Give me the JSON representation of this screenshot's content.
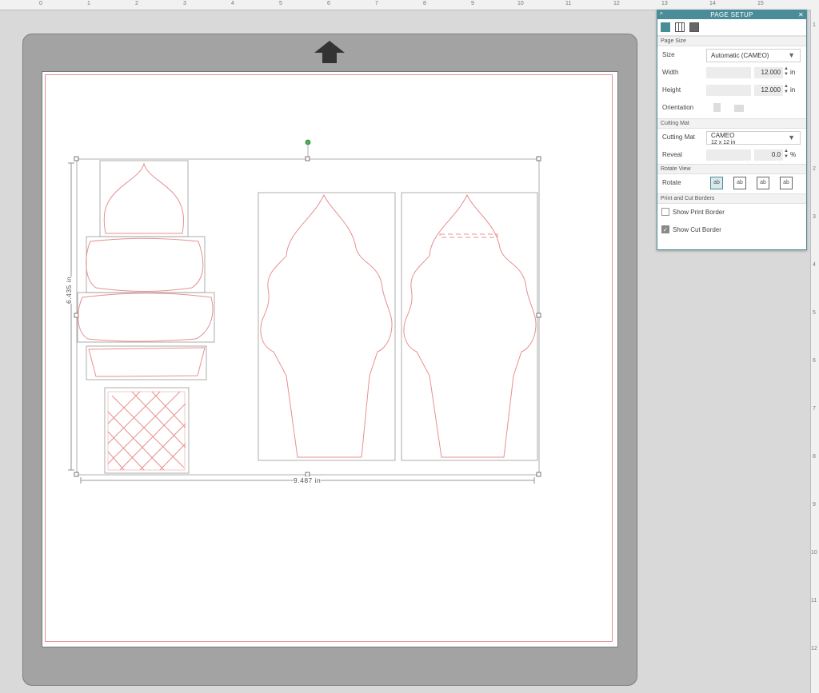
{
  "ruler": {
    "top_labels": [
      "0",
      "1",
      "2",
      "3",
      "4",
      "5",
      "6",
      "7",
      "8",
      "9",
      "10",
      "11",
      "12",
      "13",
      "14",
      "15"
    ],
    "right_labels": [
      "1",
      "2",
      "3",
      "4",
      "5",
      "6",
      "7",
      "8",
      "9",
      "10",
      "11",
      "12"
    ]
  },
  "canvas": {
    "height_dimension": "6.435 in",
    "width_dimension": "9.487 in"
  },
  "panel": {
    "title": "PAGE SETUP",
    "sections": {
      "page_size": "Page Size",
      "cutting_mat": "Cutting Mat",
      "rotate_view": "Rotate View",
      "borders": "Print and Cut Borders"
    },
    "size_label": "Size",
    "size_value": "Automatic (CAMEO)",
    "width_label": "Width",
    "width_value": "12.000",
    "height_label": "Height",
    "height_value": "12.000",
    "unit_in": "in",
    "orientation_label": "Orientation",
    "cutting_mat_label": "Cutting Mat",
    "cutting_mat_value": "CAMEO",
    "cutting_mat_sub": "12 x 12 in",
    "reveal_label": "Reveal",
    "reveal_value": "0.0",
    "unit_pct": "%",
    "rotate_label": "Rotate",
    "rotate_options": [
      "ab",
      "ab",
      "ab",
      "ab"
    ],
    "show_print_border": "Show Print Border",
    "show_cut_border": "Show Cut Border",
    "print_border_checked": false,
    "cut_border_checked": true
  },
  "colors": {
    "accent": "#4a8c98",
    "cut_line": "#e89090",
    "selection": "#4caf50"
  }
}
